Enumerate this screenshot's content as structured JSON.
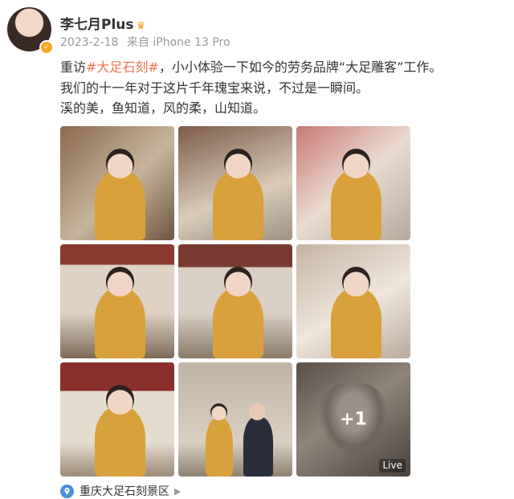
{
  "post": {
    "username": "李七月Plus",
    "crown_glyph": "♛",
    "verified_glyph": "✓",
    "date": "2023-2-18",
    "source": "来自 iPhone 13 Pro",
    "text": {
      "prefix": "重访",
      "hashtag": "#大足石刻#",
      "line1_rest": "，小小体验一下如今的劳务品牌“大足雕客”工作。",
      "line2": "我们的十一年对于这片千年瑰宝来说，不过是一瞬间。",
      "line3": "溪的美，鱼知道，风的柔，山知道。"
    },
    "photos": {
      "count": 9,
      "more_label": "+1",
      "live_label": "Live"
    },
    "location": {
      "label": "重庆大足石刻景区",
      "chevron": "▶"
    }
  },
  "colors": {
    "hashtag": "#eb7350",
    "location_pin": "#4a90d9",
    "meta": "#999999"
  }
}
